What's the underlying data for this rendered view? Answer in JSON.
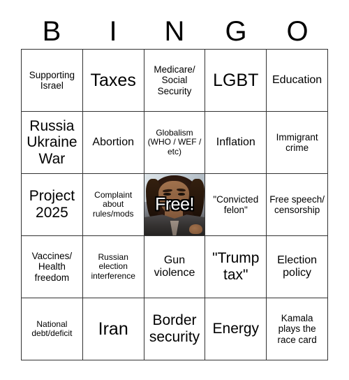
{
  "card": {
    "header_letters": [
      "B",
      "I",
      "N",
      "G",
      "O"
    ],
    "rows": [
      [
        {
          "text": "Supporting Israel",
          "size": "sm",
          "type": "text"
        },
        {
          "text": "Taxes",
          "size": "xl",
          "type": "text"
        },
        {
          "text": "Medicare/ Social Security",
          "size": "sm",
          "type": "text"
        },
        {
          "text": "LGBT",
          "size": "xl",
          "type": "text"
        },
        {
          "text": "Education",
          "size": "md",
          "type": "text"
        }
      ],
      [
        {
          "text": "Russia Ukraine War",
          "size": "lg",
          "type": "text"
        },
        {
          "text": "Abortion",
          "size": "md",
          "type": "text"
        },
        {
          "text": "Globalism (WHO / WEF / etc)",
          "size": "xs",
          "type": "text"
        },
        {
          "text": "Inflation",
          "size": "md",
          "type": "text"
        },
        {
          "text": "Immigrant crime",
          "size": "sm",
          "type": "text"
        }
      ],
      [
        {
          "text": "Project 2025",
          "size": "lg",
          "type": "text"
        },
        {
          "text": "Complaint about rules/mods",
          "size": "xs",
          "type": "text"
        },
        {
          "text": "Free!",
          "size": "xl",
          "type": "free",
          "image": "kamala-harris-photo"
        },
        {
          "text": "\"Convicted felon\"",
          "size": "sm",
          "type": "text"
        },
        {
          "text": "Free speech/ censorship",
          "size": "sm",
          "type": "text"
        }
      ],
      [
        {
          "text": "Vaccines/ Health freedom",
          "size": "sm",
          "type": "text"
        },
        {
          "text": "Russian election interference",
          "size": "xs",
          "type": "text"
        },
        {
          "text": "Gun violence",
          "size": "md",
          "type": "text"
        },
        {
          "text": "\"Trump tax\"",
          "size": "lg",
          "type": "text"
        },
        {
          "text": "Election policy",
          "size": "md",
          "type": "text"
        }
      ],
      [
        {
          "text": "National debt/deficit",
          "size": "xs",
          "type": "text"
        },
        {
          "text": "Iran",
          "size": "xl",
          "type": "text"
        },
        {
          "text": "Border security",
          "size": "lg",
          "type": "text"
        },
        {
          "text": "Energy",
          "size": "lg",
          "type": "text"
        },
        {
          "text": "Kamala plays the race card",
          "size": "sm",
          "type": "text"
        }
      ]
    ]
  },
  "colors": {
    "background": "#ffffff",
    "border": "#333333",
    "text": "#000000",
    "free_text": "#ffffff",
    "free_text_outline": "#000000"
  }
}
